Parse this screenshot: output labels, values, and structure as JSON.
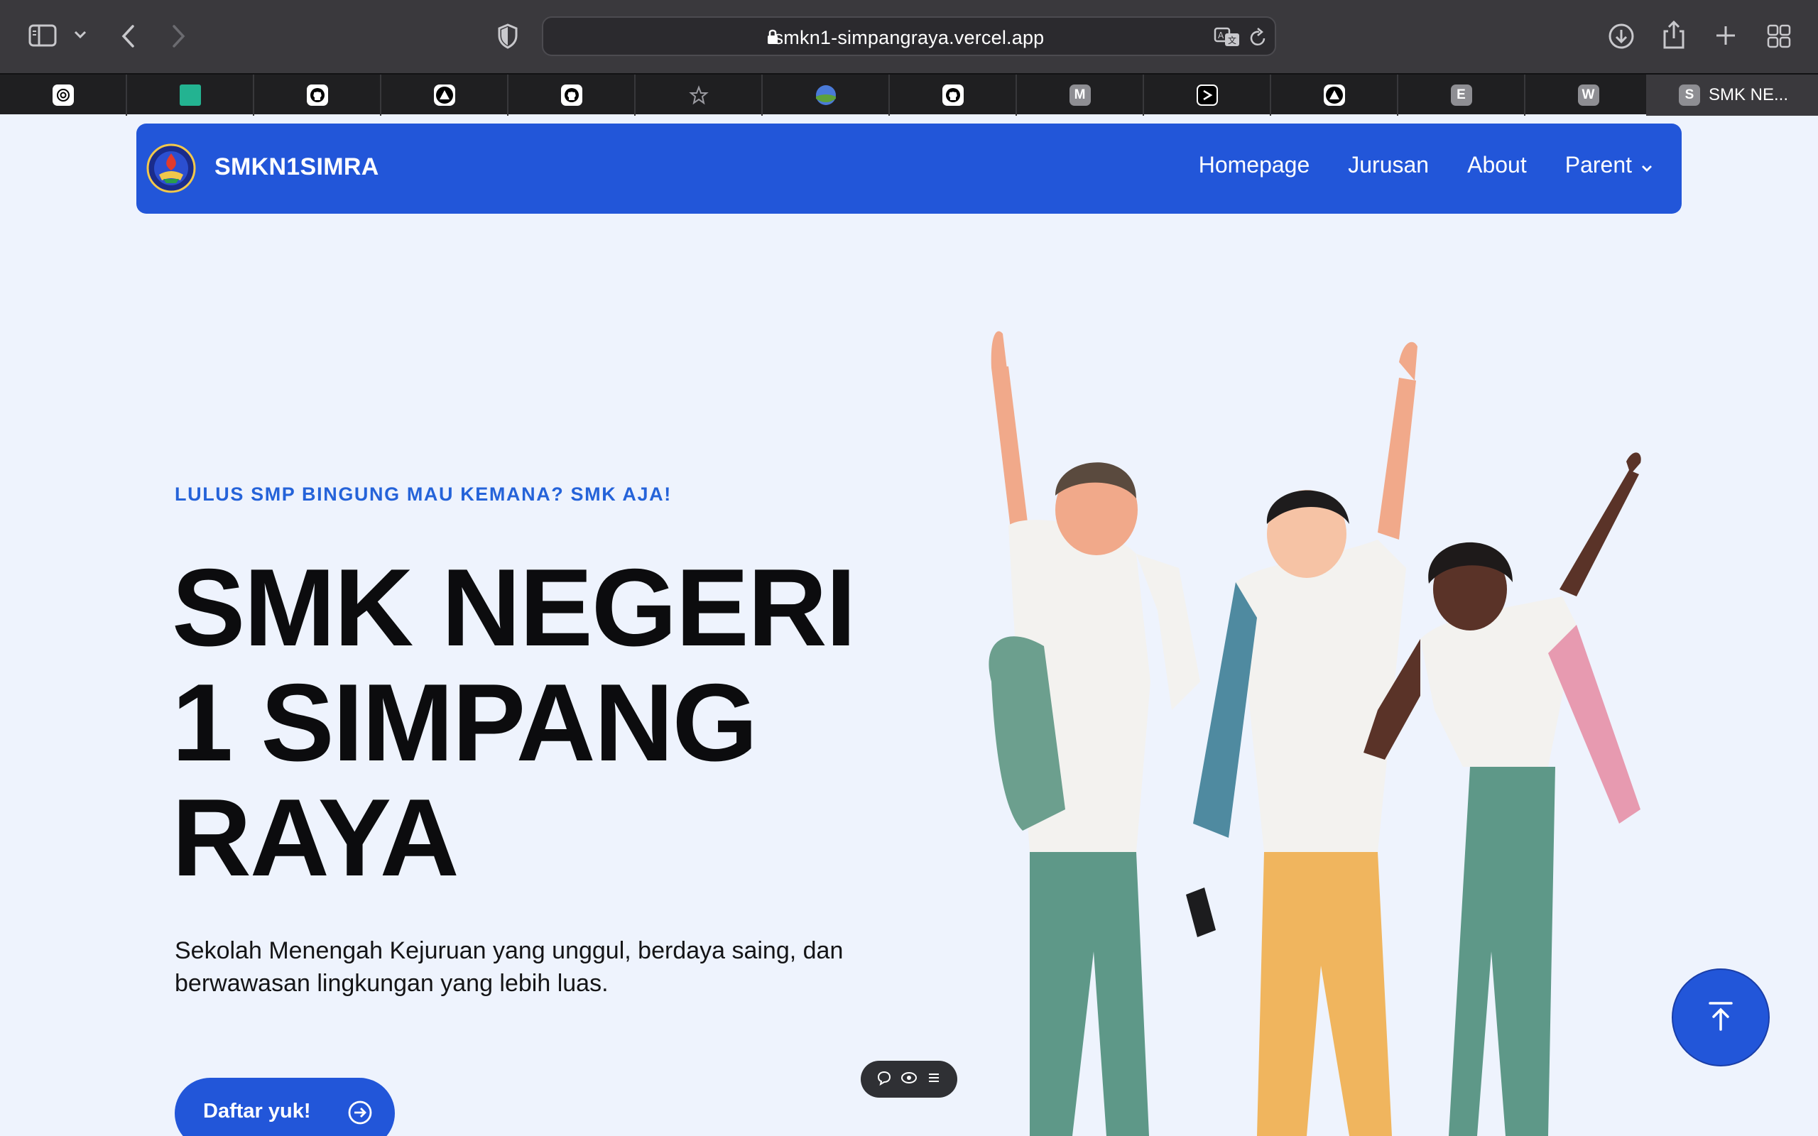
{
  "browser": {
    "url": "smkn1-simpangraya.vercel.app",
    "active_tab_title": "SMK NE...",
    "active_tab_letter": "S",
    "favicons": [
      {
        "icon": "openai-icon"
      },
      {
        "icon": "green-square-icon"
      },
      {
        "icon": "github-icon"
      },
      {
        "icon": "triangle-app-icon"
      },
      {
        "icon": "github-icon"
      },
      {
        "icon": "star-icon"
      },
      {
        "icon": "globe-landscape-icon"
      },
      {
        "icon": "github-icon"
      },
      {
        "icon": "letter-icon",
        "letter": "M"
      },
      {
        "icon": "terminal-prompt-icon"
      },
      {
        "icon": "triangle-app-icon"
      },
      {
        "icon": "letter-icon",
        "letter": "E"
      },
      {
        "icon": "letter-icon",
        "letter": "W"
      }
    ]
  },
  "nav": {
    "brand": "SMKN1SIMRA",
    "links": [
      "Homepage",
      "Jurusan",
      "About",
      "Parent"
    ]
  },
  "hero": {
    "eyebrow": "LULUS SMP BINGUNG MAU KEMANA? SMK AJA!",
    "title_lines": [
      "SMK NEGERI",
      "1 SIMPANG",
      "RAYA"
    ],
    "description": "Sekolah Menengah Kejuruan yang unggul, berdaya saing, dan berwawasan lingkungan yang lebih luas.",
    "cta": "Daftar yuk!"
  },
  "colors": {
    "primary": "#2256d9",
    "page_bg": "#eef3fd",
    "eyebrow": "#2563d9",
    "chrome": "#3a393d"
  }
}
